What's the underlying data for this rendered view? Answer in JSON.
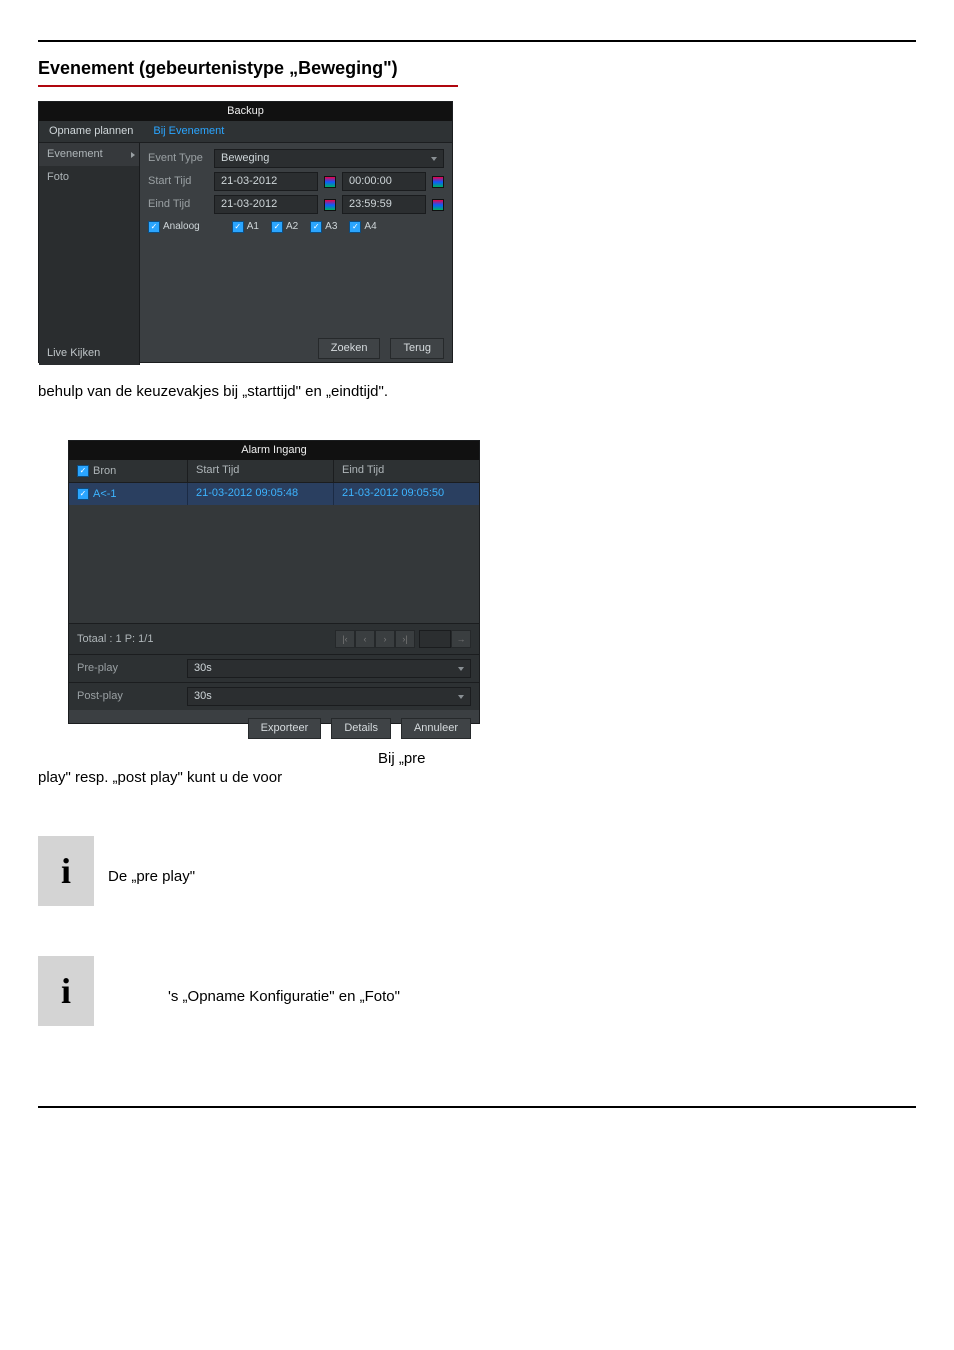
{
  "heading": "Evenement (gebeurtenistype „Beweging\")",
  "shot1": {
    "title": "Backup",
    "tab1": "Opname plannen",
    "tab2": "Bij Evenement",
    "side": {
      "evenement": "Evenement",
      "foto": "Foto",
      "live": "Live Kijken"
    },
    "rows": {
      "eventtype_lbl": "Event Type",
      "eventtype_val": "Beweging",
      "start_lbl": "Start Tijd",
      "start_date": "21-03-2012",
      "start_time": "00:00:00",
      "eind_lbl": "Eind Tijd",
      "eind_date": "21-03-2012",
      "eind_time": "23:59:59",
      "analoog": "Analoog",
      "a1": "A1",
      "a2": "A2",
      "a3": "A3",
      "a4": "A4"
    },
    "btn_zoeken": "Zoeken",
    "btn_terug": "Terug"
  },
  "para1": "behulp van de keuzevakjes bij „starttijd\" en „eindtijd\".",
  "shot2": {
    "title": "Alarm Ingang",
    "h_bron": "Bron",
    "h_start": "Start Tijd",
    "h_eind": "Eind Tijd",
    "d_bron": "A<-1",
    "d_start": "21-03-2012 09:05:48",
    "d_eind": "21-03-2012 09:05:50",
    "totaal": "Totaal : 1  P: 1/1",
    "pre_lbl": "Pre-play",
    "pre_val": "30s",
    "post_lbl": "Post-play",
    "post_val": "30s",
    "btn_export": "Exporteer",
    "btn_details": "Details",
    "btn_annul": "Annuleer"
  },
  "float_right": "Bij „pre",
  "para2": "play\" resp. „post play\" kunt u de voor",
  "info1": "De „pre play\"",
  "info2": "'s „Opname Konfiguratie\" en „Foto\""
}
